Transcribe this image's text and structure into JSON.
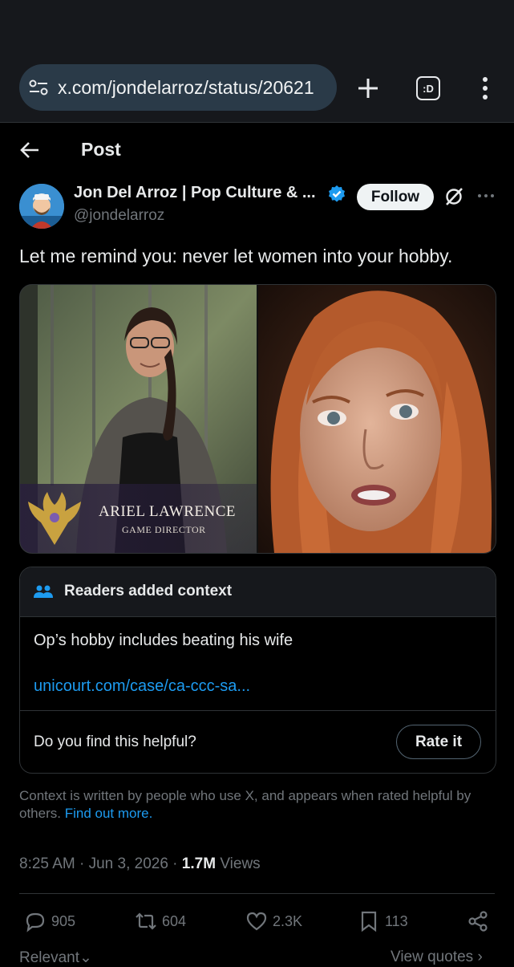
{
  "browser": {
    "url": "x.com/jondelarroz/status/20621",
    "tune_icon": "tune-icon",
    "new_tab_icon": "plus-icon",
    "tabs_icon": "tab-switcher-icon",
    "tabs_count": ":D",
    "menu_icon": "more-vertical-icon"
  },
  "header": {
    "back_icon": "arrow-left-icon",
    "title": "Post"
  },
  "post": {
    "author_name": "Jon Del Arroz | Pop Culture & ...",
    "handle": "@jondelarroz",
    "follow_label": "Follow",
    "text": "Let me remind you: never let women into your hobby.",
    "media": {
      "left_caption_name": "ARIEL LAWRENCE",
      "left_caption_role": "GAME DIRECTOR"
    },
    "timestamp": "8:25 AM · Jun 3, 2026 · ",
    "views_count": "1.7M",
    "views_label": " Views"
  },
  "community_note": {
    "title": "Readers added context",
    "body": "Op’s hobby includes beating his wife",
    "link": "unicourt.com/case/ca-ccc-sa...",
    "helpful_question": "Do you find this helpful?",
    "rate_label": "Rate it",
    "disclaimer": "Context is written by people who use X, and appears when rated helpful by others.",
    "find_out_more": "Find out more."
  },
  "actions": {
    "replies": "905",
    "reposts": "604",
    "likes": "2.3K",
    "bookmarks": "113"
  },
  "footer": {
    "relevant_label": "Relevant",
    "view_quotes_label": "View quotes"
  },
  "colors": {
    "background": "#000000",
    "accent": "#1d9bf0",
    "muted": "#71767b",
    "browser_bar": "#16181c",
    "url_pill": "#2a3a48"
  }
}
